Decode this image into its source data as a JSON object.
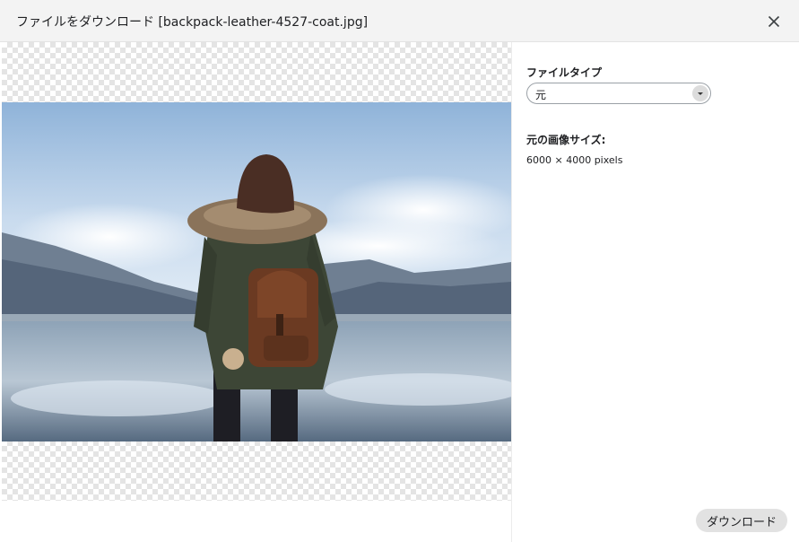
{
  "dialog": {
    "title": "ファイルをダウンロード [backpack-leather-4527-coat.jpg]",
    "close_icon": "close-icon"
  },
  "preview": {
    "image_name": "backpack-leather-4527-coat.jpg",
    "background": "transparency-checkerboard"
  },
  "panel": {
    "file_type_label": "ファイルタイプ",
    "file_type_value": "元",
    "original_size_label": "元の画像サイズ:",
    "original_size_value": "6000 × 4000 pixels"
  },
  "footer": {
    "download_label": "ダウンロード"
  }
}
